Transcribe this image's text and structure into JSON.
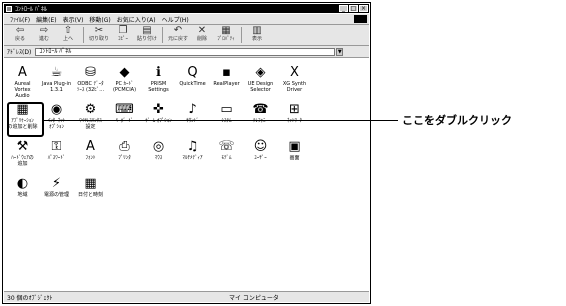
{
  "window": {
    "title": "ｺﾝﾄﾛｰﾙ ﾊﾟﾈﾙ",
    "min_glyph": "_",
    "max_glyph": "□",
    "close_glyph": "×"
  },
  "menu": [
    "ﾌｧｲﾙ(F)",
    "編集(E)",
    "表示(V)",
    "移動(G)",
    "お気に入り(A)",
    "ヘルプ(H)"
  ],
  "toolbar": [
    {
      "icon": "back-arrow",
      "glyph": "⇦",
      "label": "戻る"
    },
    {
      "icon": "forward-arrow",
      "glyph": "⇨",
      "label": "進む"
    },
    {
      "icon": "up-folder",
      "glyph": "⇧",
      "label": "上へ"
    },
    {
      "icon": "scissors",
      "glyph": "✂",
      "label": "切り取り"
    },
    {
      "icon": "copy",
      "glyph": "❐",
      "label": "ｺﾋﾟｰ"
    },
    {
      "icon": "paste",
      "glyph": "▤",
      "label": "貼り付け"
    },
    {
      "icon": "undo",
      "glyph": "↶",
      "label": "元に戻す"
    },
    {
      "icon": "delete-x",
      "glyph": "✕",
      "label": "削除"
    },
    {
      "icon": "properties",
      "glyph": "▦",
      "label": "ﾌﾟﾛﾊﾟﾃｨ"
    },
    {
      "icon": "views",
      "glyph": "▥",
      "label": "表示"
    }
  ],
  "address": {
    "label": "ｱﾄﾞﾚｽ(D)",
    "value": "ｺﾝﾄﾛｰﾙ ﾊﾟﾈﾙ",
    "dropdown_glyph": "▼"
  },
  "icons": [
    {
      "label": "Aureal Vortex\nAudio",
      "icon": "aureal-a-icon",
      "glyph": "A"
    },
    {
      "label": "Java Plug-in\n1.3.1",
      "icon": "java-cup-icon",
      "glyph": "☕"
    },
    {
      "label": "ODBC ﾃﾞｰﾀ\nｿｰｽ (32ﾋﾞ...",
      "icon": "odbc-database-icon",
      "glyph": "⛁"
    },
    {
      "label": "PC ｶｰﾄﾞ\n(PCMCIA)",
      "icon": "pc-card-icon",
      "glyph": "◆"
    },
    {
      "label": "PRISM\nSettings",
      "icon": "prism-info-icon",
      "glyph": "ℹ"
    },
    {
      "label": "QuickTime",
      "icon": "quicktime-icon",
      "glyph": "Q"
    },
    {
      "label": "RealPlayer",
      "icon": "realplayer-icon",
      "glyph": "▪"
    },
    {
      "label": "UE Design\nSelector",
      "icon": "ue-design-icon",
      "glyph": "◈"
    },
    {
      "label": "XG Synth\nDriver",
      "icon": "xg-soft-icon",
      "glyph": "Ⅹ"
    },
    {
      "label": "ｱﾌﾟﾘｹｰｼｮﾝ\nの追加と削除",
      "icon": "add-remove-programs-icon",
      "glyph": "▦"
    },
    {
      "label": "ｲﾝﾀｰﾈｯﾄ\nｵﾌﾟｼｮﾝ",
      "icon": "internet-options-icon",
      "glyph": "◉"
    },
    {
      "label": "ﾜｲﾔﾚｽﾘﾝｸｽ\n設定",
      "icon": "wireless-icon",
      "glyph": "⚙"
    },
    {
      "label": "ｷｰﾎﾞｰﾄﾞ",
      "icon": "keyboard-icon",
      "glyph": "⌨"
    },
    {
      "label": "ｹﾞｰﾑ ｵﾌﾟｼｮﾝ",
      "icon": "game-controller-icon",
      "glyph": "✜"
    },
    {
      "label": "ｻｳﾝﾄﾞ",
      "icon": "sound-icon",
      "glyph": "♪"
    },
    {
      "label": "ｼｽﾃﾑ",
      "icon": "system-monitor-icon",
      "glyph": "▭"
    },
    {
      "label": "ﾃﾚﾌｫﾆｰ",
      "icon": "telephony-icon",
      "glyph": "☎"
    },
    {
      "label": "ﾈｯﾄﾜｰｸ",
      "icon": "network-icon",
      "glyph": "⊞"
    },
    {
      "label": "ﾊｰﾄﾞｳｪｱの\n追加",
      "icon": "add-hardware-icon",
      "glyph": "⚒"
    },
    {
      "label": "ﾊﾟｽﾜｰﾄﾞ",
      "icon": "password-key-icon",
      "glyph": "⚿"
    },
    {
      "label": "ﾌｫﾝﾄ",
      "icon": "fonts-folder-icon",
      "glyph": "A"
    },
    {
      "label": "ﾌﾟﾘﾝﾀ",
      "icon": "printers-icon",
      "glyph": "⎙"
    },
    {
      "label": "ﾏｳｽ",
      "icon": "mouse-icon",
      "glyph": "◎"
    },
    {
      "label": "ﾏﾙﾁﾒﾃﾞｨｱ",
      "icon": "multimedia-icon",
      "glyph": "♫"
    },
    {
      "label": "ﾓﾃﾞﾑ",
      "icon": "modem-icon",
      "glyph": "☏"
    },
    {
      "label": "ﾕｰｻﾞｰ",
      "icon": "users-icon",
      "glyph": "☺"
    },
    {
      "label": "画面",
      "icon": "display-icon",
      "glyph": "▣"
    },
    {
      "label": "地域",
      "icon": "regional-globe-icon",
      "glyph": "◐"
    },
    {
      "label": "電源の管理",
      "icon": "power-management-icon",
      "glyph": "⚡"
    },
    {
      "label": "日付と時刻",
      "icon": "date-time-icon",
      "glyph": "▦"
    }
  ],
  "status": {
    "left": "30 個のｵﾌﾞｼﾞｪｸﾄ",
    "right": "マイ コンピュータ"
  },
  "callout": "ここをダブルクリック"
}
